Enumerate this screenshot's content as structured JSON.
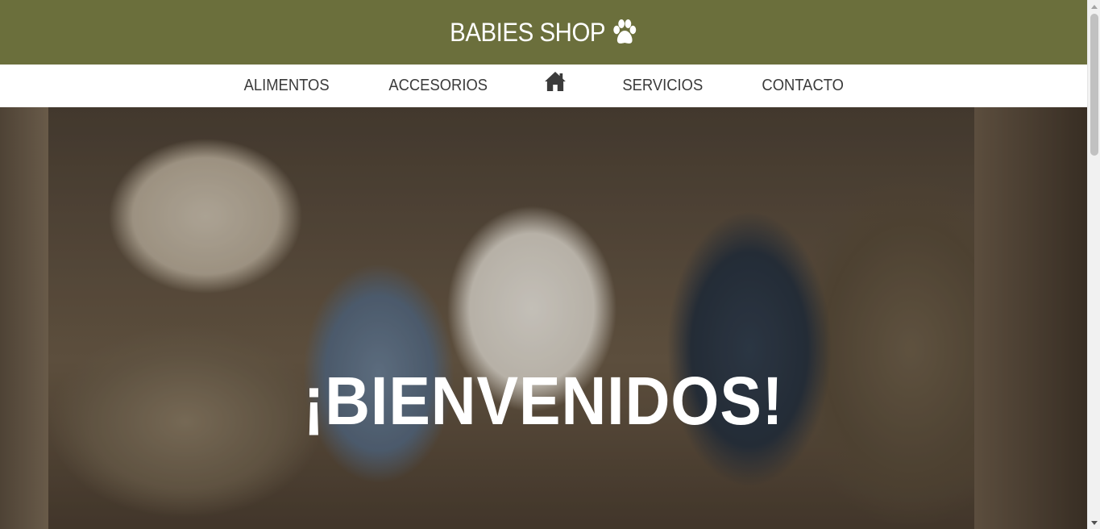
{
  "header": {
    "brand_name": "BABIES SHOP",
    "brand_icon": "paw-icon",
    "background_color": "#6b6f3c"
  },
  "nav": {
    "items": [
      {
        "label": "ALIMENTOS"
      },
      {
        "label": "ACCESORIOS"
      },
      {
        "label": "",
        "icon": "home-icon"
      },
      {
        "label": "SERVICIOS"
      },
      {
        "label": "CONTACTO"
      }
    ]
  },
  "hero": {
    "heading": "¡BIENVENIDOS!"
  }
}
